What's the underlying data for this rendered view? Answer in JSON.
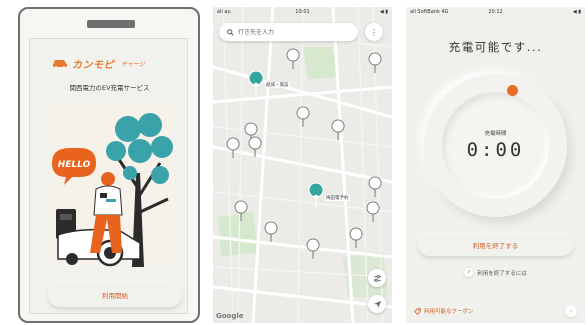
{
  "welcome": {
    "logo_text": "カンモピ",
    "logo_sub": "チャージ",
    "subtitle": "関西電力のEV充電サービス",
    "speech_bubble": "HELLO",
    "start_button": "利用開始"
  },
  "map": {
    "status": {
      "carrier": "all au",
      "time": "10:01",
      "icons": "◀ ▮"
    },
    "search_placeholder": "行き先を入力",
    "menu_label": "⋮",
    "pins": [
      {
        "label": "越城・施設"
      },
      {
        "label": "梅田電予約"
      }
    ],
    "google_label": "Google"
  },
  "charging": {
    "status": {
      "carrier": "all SoftBank 4G",
      "time": "20:12",
      "icons": "◀ ▮"
    },
    "title": "充電可能です...",
    "time_label": "充電時間",
    "time_value": "0:00",
    "end_button": "利用を終了する",
    "help_mark": "?",
    "help_text": "利用を終了するには",
    "coupon_text": "利用可能なクーポン",
    "coupon_arrow": "›",
    "colors": {
      "accent": "#ea6a26",
      "text_accent": "#d35d27"
    }
  }
}
